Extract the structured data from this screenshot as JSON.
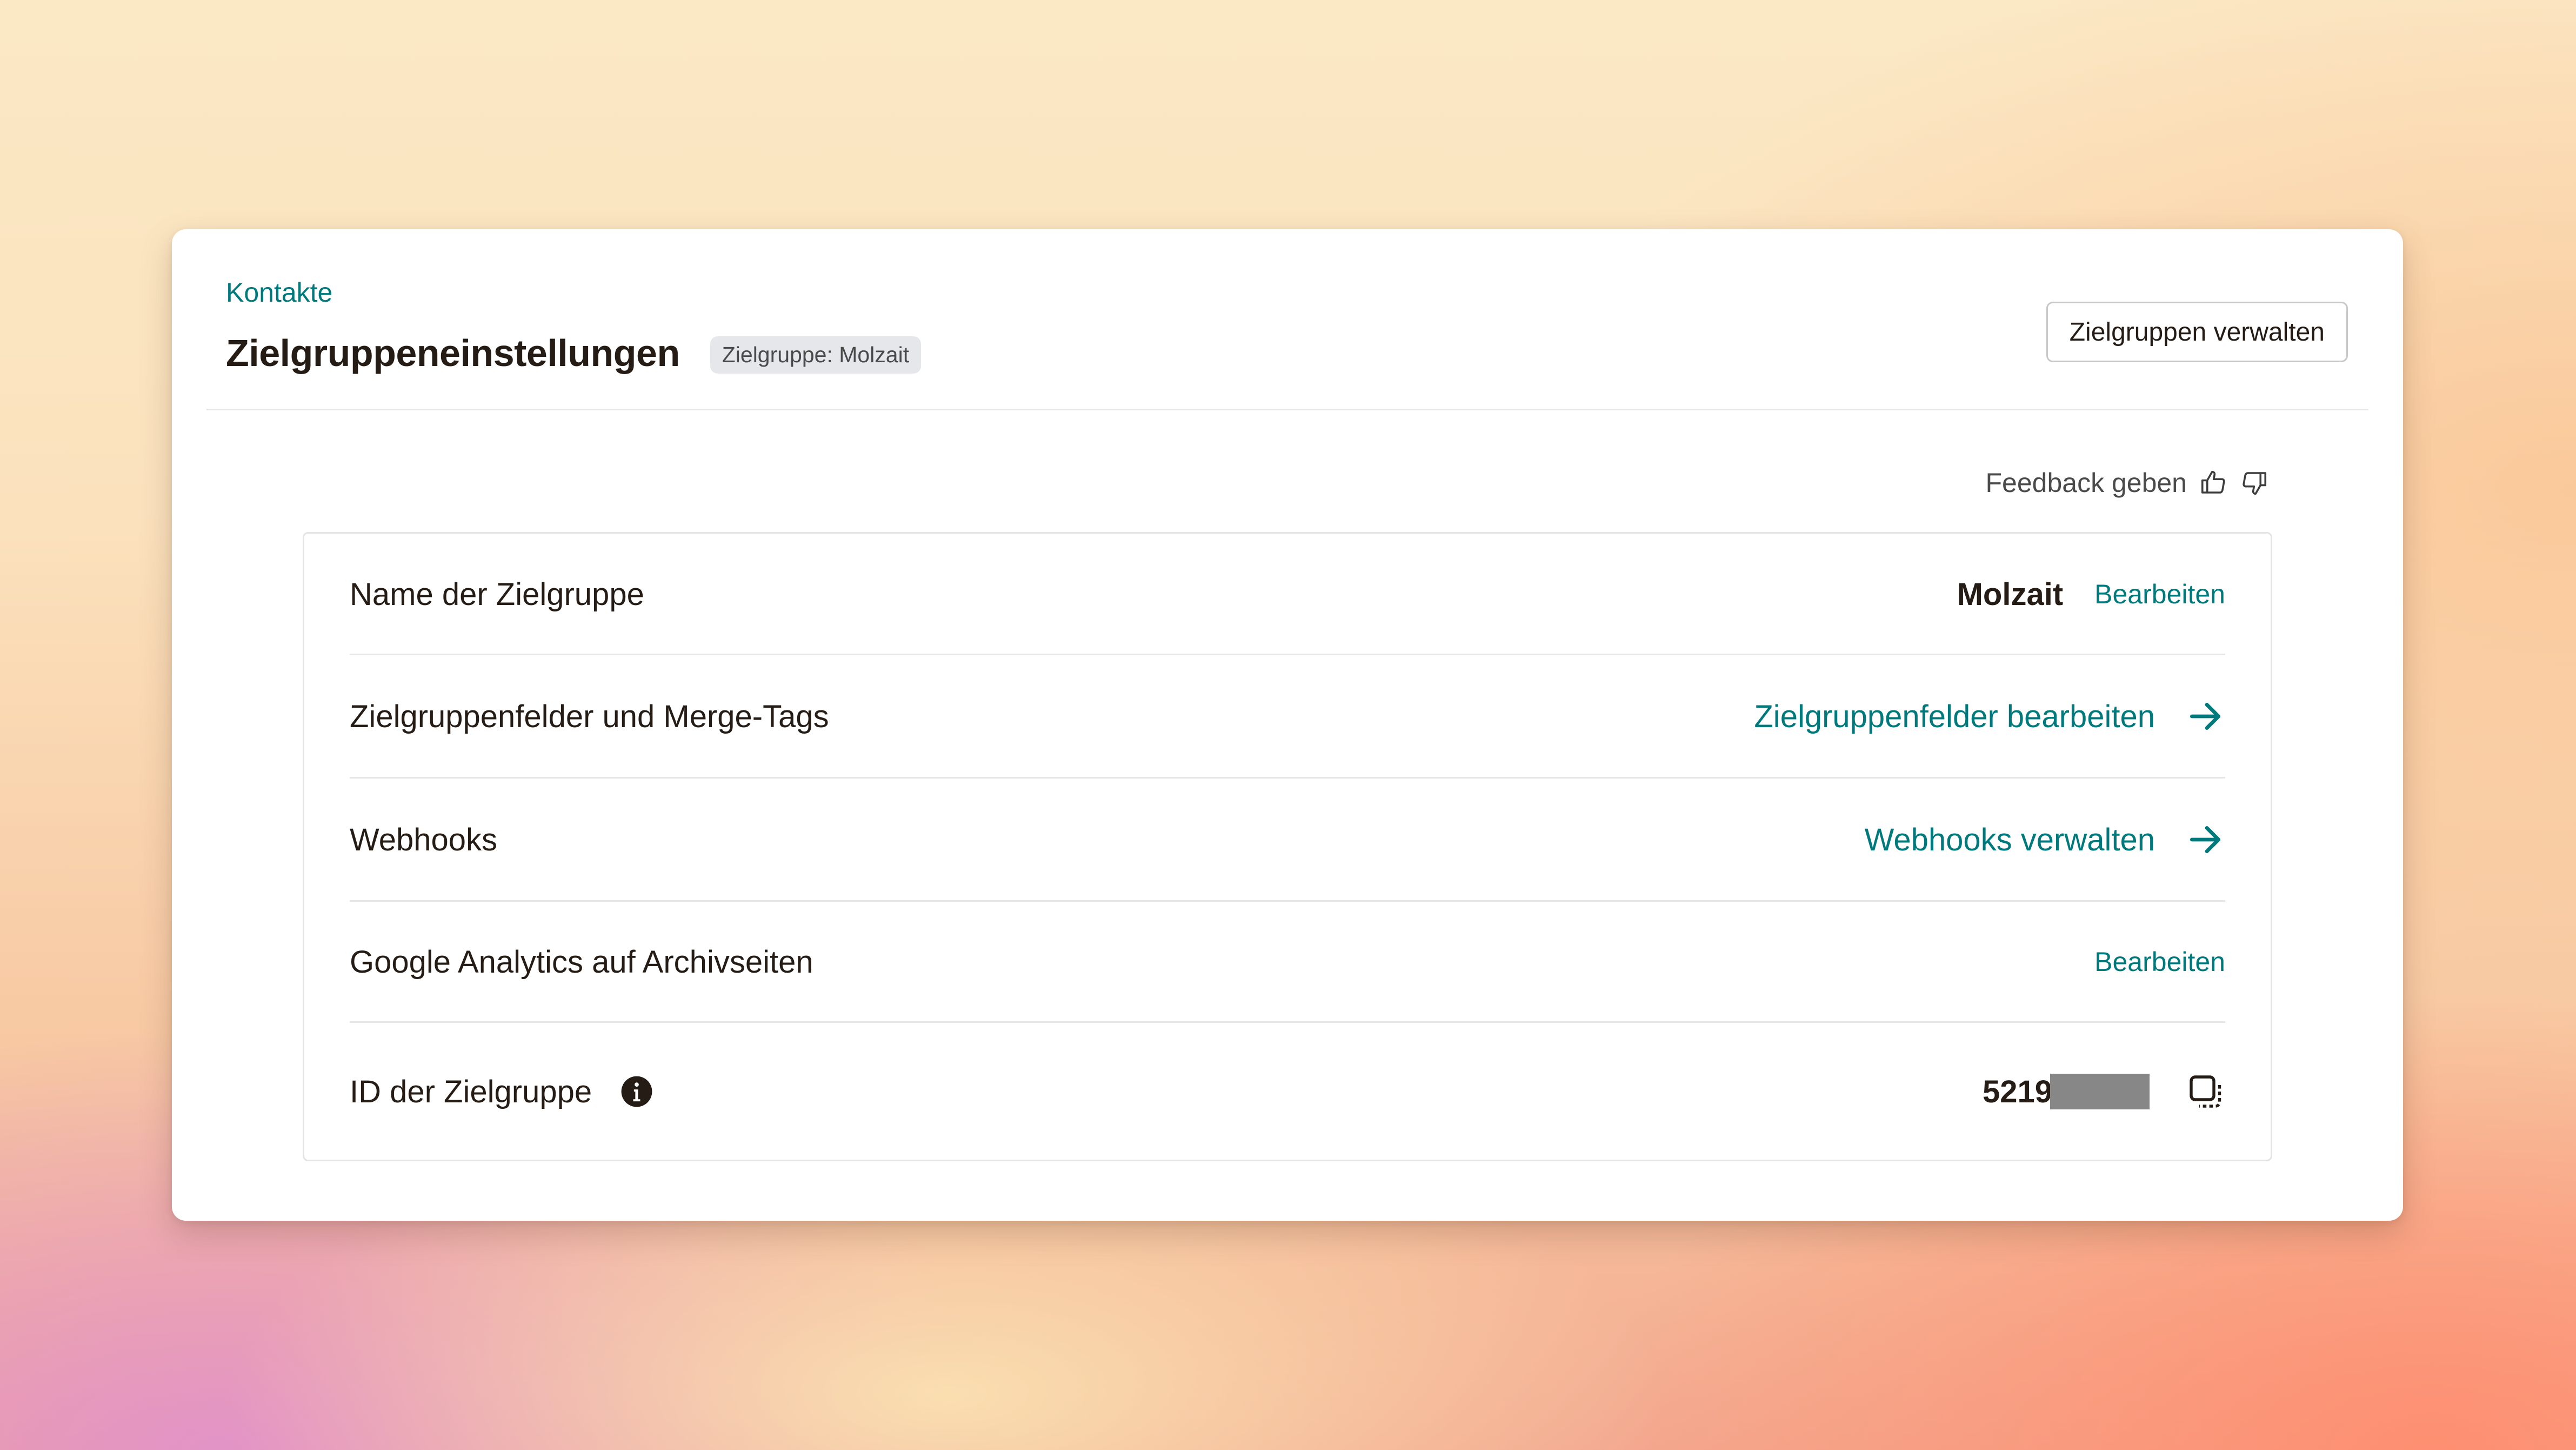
{
  "breadcrumb": {
    "label": "Kontakte"
  },
  "header": {
    "title": "Zielgruppeneinstellungen",
    "badge": "Zielgruppe: Molzait",
    "manage_button": "Zielgruppen verwalten"
  },
  "feedback": {
    "label": "Feedback geben",
    "icons": [
      "thumbs-up-icon",
      "thumbs-down-icon"
    ]
  },
  "rows": [
    {
      "label": "Name der Zielgruppe",
      "value": "Molzait",
      "action": "Bearbeiten"
    },
    {
      "label": "Zielgruppenfelder und Merge-Tags",
      "action": "Zielgruppenfelder bearbeiten",
      "icon": "arrow-right-icon"
    },
    {
      "label": "Webhooks",
      "action": "Webhooks verwalten",
      "icon": "arrow-right-icon"
    },
    {
      "label": "Google Analytics auf Archivseiten",
      "action": "Bearbeiten"
    },
    {
      "label": "ID der Zielgruppe",
      "value": "5219",
      "value_masked": true,
      "icons": [
        "info-icon",
        "copy-icon"
      ]
    }
  ],
  "colors": {
    "accent": "#00797c",
    "text": "#241c15",
    "badge_bg": "#e5e7eb",
    "mask": "#878787"
  }
}
